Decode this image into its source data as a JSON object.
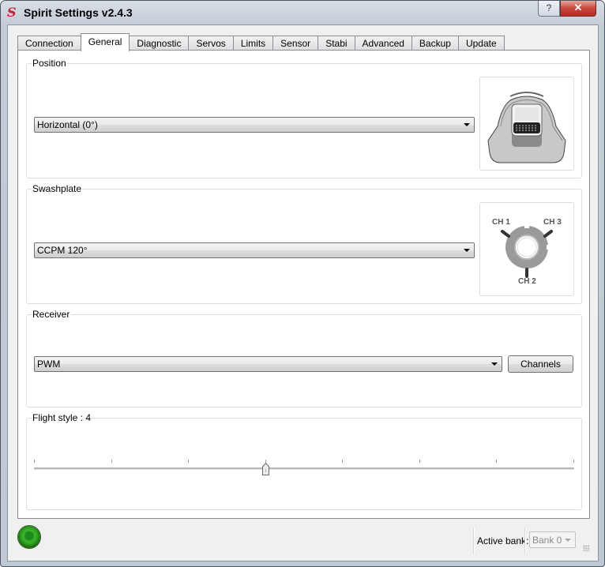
{
  "window": {
    "title": "Spirit Settings v2.4.3",
    "help_label": "?",
    "close_label": "✕"
  },
  "tabs": [
    {
      "label": "Connection",
      "active": false
    },
    {
      "label": "General",
      "active": true
    },
    {
      "label": "Diagnostic",
      "active": false
    },
    {
      "label": "Servos",
      "active": false
    },
    {
      "label": "Limits",
      "active": false
    },
    {
      "label": "Sensor",
      "active": false
    },
    {
      "label": "Stabi",
      "active": false
    },
    {
      "label": "Advanced",
      "active": false
    },
    {
      "label": "Backup",
      "active": false
    },
    {
      "label": "Update",
      "active": false
    }
  ],
  "position": {
    "title": "Position",
    "selected": "Horizontal (0°)",
    "image": "unit-mounting-icon"
  },
  "swashplate": {
    "title": "Swashplate",
    "selected": "CCPM 120°",
    "image": "swashplate-icon",
    "channels": [
      "CH 1",
      "CH 3",
      "CH 2"
    ]
  },
  "receiver": {
    "title": "Receiver",
    "selected": "PWM",
    "channels_button": "Channels"
  },
  "flight_style": {
    "title": "Flight style : 4",
    "value": 4,
    "min": 1,
    "max": 8
  },
  "status": {
    "connection_led": "connected",
    "led_color": "#3cb82c",
    "active_bank_label": "Active bank:",
    "active_bank_value": "Bank 0"
  }
}
